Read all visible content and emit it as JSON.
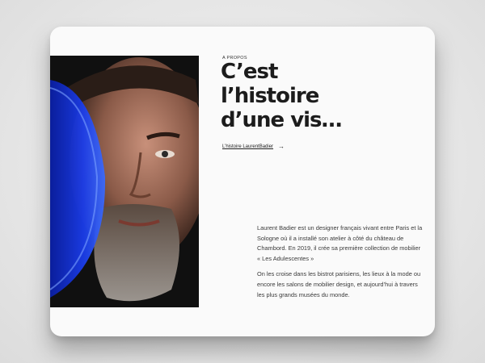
{
  "section": {
    "eyebrow": "A PROPOS",
    "headline_lines": [
      "C’est",
      "l’histoire",
      "d’une vis…"
    ],
    "link_label": "L’histoire LaurentBadier",
    "link_icon": "arrow-right-icon",
    "paragraphs": [
      "Laurent Badier est un designer français vivant entre Paris et la Sologne où il a installé son atelier à côté du château de Chambord. En 2019, il crée sa première collection de mobilier « Les Adulescentes »",
      "On les croise dans les bistrot parisiens, les lieux à la mode ou encore les salons de mobilier design, et aujourd’hui à travers les plus grands musées du monde."
    ]
  },
  "colors": {
    "background": "#e9e9e9",
    "card": "#fafafa",
    "text": "#1c1c1c",
    "lens_blue": "#1a3df0"
  }
}
